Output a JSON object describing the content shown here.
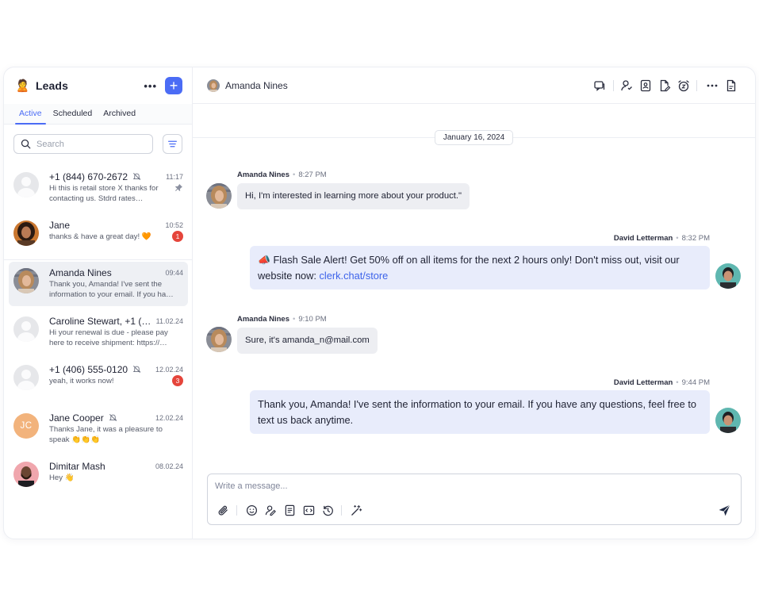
{
  "sidebar": {
    "folder_icon": "🙎",
    "title": "Leads",
    "more_label": "•••",
    "add_label": "+",
    "tabs": [
      {
        "label": "Active",
        "active": true
      },
      {
        "label": "Scheduled",
        "active": false
      },
      {
        "label": "Archived",
        "active": false
      }
    ],
    "search": {
      "placeholder": "Search",
      "value": ""
    },
    "conversations": [
      {
        "name": "+1 (844) 670-2672",
        "time": "11:17",
        "snippet": "Hi this is retail store X thanks for contacting us. Stdrd rates…",
        "muted": true,
        "pinned": true,
        "avatar": "placeholder"
      },
      {
        "name": "Jane",
        "time": "10:52",
        "snippet": "thanks & have a great day! 🧡",
        "badge": "1",
        "avatar": "photo"
      },
      {
        "name": "Amanda Nines",
        "time": "09:44",
        "snippet": "Thank you, Amanda! I've sent the information to your email. If you ha…",
        "selected": true,
        "avatar": "photo"
      },
      {
        "name": "Caroline Stewart, +1 (5…",
        "time": "11.02.24",
        "snippet": "Hi your renewal is due - please pay here to receive shipment: https://…",
        "avatar": "placeholder"
      },
      {
        "name": "+1 (406) 555-0120",
        "time": "12.02.24",
        "snippet": "yeah, it works now!",
        "muted": true,
        "badge": "3",
        "avatar": "placeholder"
      },
      {
        "name": "Jane Cooper",
        "time": "12.02.24",
        "snippet": "Thanks Jane, it was a pleasure to speak 👏👏👏",
        "muted": true,
        "avatar": "initials",
        "initials": "JC"
      },
      {
        "name": "Dimitar Mash",
        "time": "08.02.24",
        "snippet": "Hey 👋",
        "avatar": "photo"
      }
    ]
  },
  "chat": {
    "contact_name": "Amanda Nines",
    "header_icons": [
      "chat-bubbles-icon",
      "assign-user-icon",
      "contact-card-icon",
      "edit-document-icon",
      "snooze-clock-icon",
      "more-icon",
      "document-icon"
    ],
    "date_divider": "January 16, 2024",
    "messages": [
      {
        "direction": "in",
        "sender": "Amanda Nines",
        "time": "8:27 PM",
        "text": "Hi, I'm interested in learning more about your product.\""
      },
      {
        "direction": "out",
        "sender": "David Letterman",
        "time": "8:32 PM",
        "text_line1": "📣 Flash Sale Alert! Get 50% off on all items for the next 2 hours only! Don't miss out, visit our",
        "text_line2_prefix": "website now: ",
        "link": "clerk.chat/store"
      },
      {
        "direction": "in",
        "sender": "Amanda Nines",
        "time": "9:10 PM",
        "text": "Sure, it's amanda_n@mail.com"
      },
      {
        "direction": "out",
        "sender": "David Letterman",
        "time": "9:44 PM",
        "text": "Thank you, Amanda! I've sent the information to your email. If you have any questions, feel free to text us back anytime."
      }
    ],
    "composer": {
      "placeholder": "Write a message...",
      "value": "",
      "tools": [
        "attach-icon",
        "emoji-icon",
        "contact-share-icon",
        "template-icon",
        "code-icon",
        "schedule-icon",
        "magic-wand-icon"
      ]
    }
  },
  "colors": {
    "accent": "#4b6cf5",
    "badge": "#e5453b",
    "incoming_bubble": "#edeef2",
    "outgoing_bubble": "#e8ecfb",
    "link": "#3d63ea"
  }
}
